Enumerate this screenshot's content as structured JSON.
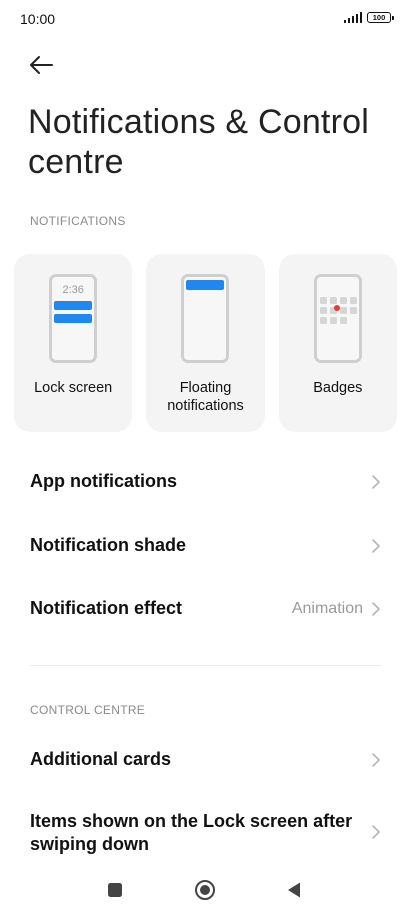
{
  "status_bar": {
    "time": "10:00",
    "battery": "100"
  },
  "page": {
    "title": "Notifications & Control centre"
  },
  "notifications_section": {
    "header": "NOTIFICATIONS",
    "cards": [
      {
        "label": "Lock screen",
        "preview_time": "2:36",
        "icon": "lock-screen-preview-icon"
      },
      {
        "label": "Floating notifications",
        "icon": "floating-notifications-preview-icon"
      },
      {
        "label": "Badges",
        "icon": "badges-preview-icon"
      }
    ],
    "rows": [
      {
        "label": "App notifications",
        "value": ""
      },
      {
        "label": "Notification shade",
        "value": ""
      },
      {
        "label": "Notification effect",
        "value": "Animation"
      }
    ]
  },
  "control_centre_section": {
    "header": "CONTROL CENTRE",
    "rows": [
      {
        "label": "Additional cards",
        "value": ""
      },
      {
        "label": "Items shown on the Lock screen after swiping down",
        "value": ""
      }
    ]
  },
  "colors": {
    "accent": "#1e88f0",
    "badge_dot": "#e53935",
    "card_bg": "#f4f4f4",
    "muted_text": "#8a8a8a"
  },
  "nav_bar": {
    "icons": [
      "recents-square-icon",
      "home-circle-icon",
      "back-triangle-icon"
    ]
  }
}
